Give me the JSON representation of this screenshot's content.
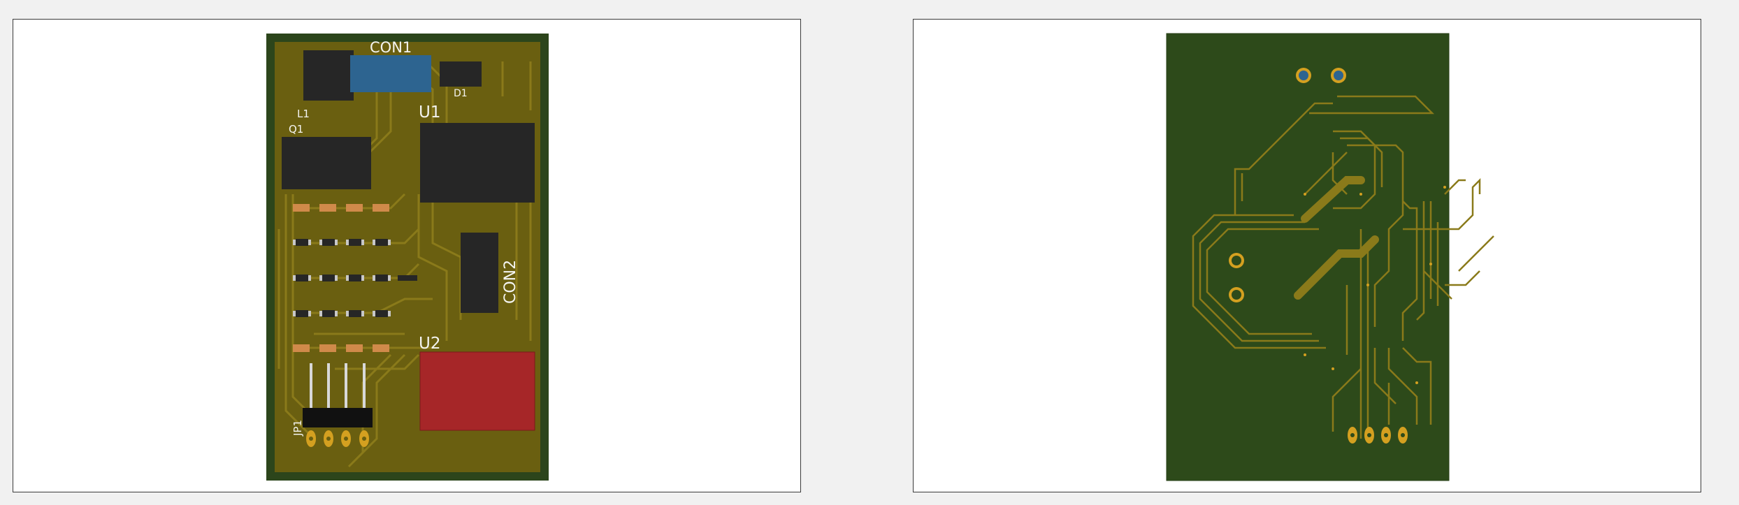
{
  "views": [
    {
      "id": "top",
      "designators": {
        "con1": "CON1",
        "con2": "CON2",
        "u1": "U1",
        "u2": "U2",
        "d1": "D1",
        "l1": "L1",
        "q1": "Q1",
        "jp1": "JP1"
      }
    },
    {
      "id": "bottom"
    }
  ],
  "colors": {
    "background": "#f1f1f1",
    "panel": "#ffffff",
    "copper_fill": "#6a5f10",
    "board_edge": "#2c451b",
    "soldermask_bottom": "#2d4a1a",
    "trace": "#8a7a1a",
    "ic_body": "#262626",
    "connector_blue": "#2d6490",
    "relay_red": "#a62628",
    "pad": "#d08a4a",
    "gold": "#d4a020",
    "silkscreen": "#f4f4f0"
  }
}
